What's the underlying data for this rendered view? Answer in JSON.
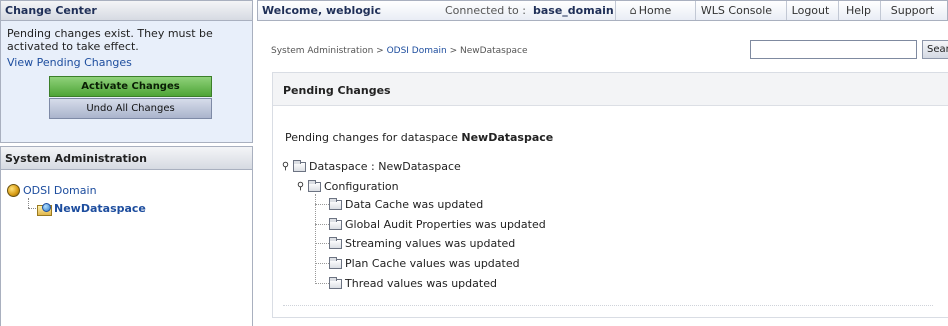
{
  "change_center": {
    "title": "Change Center",
    "message": "Pending changes exist. They must be activated to take effect.",
    "view_link": "View Pending Changes",
    "activate_label": "Activate Changes",
    "undo_label": "Undo All Changes",
    "activate_color": "#4ea537"
  },
  "system_admin": {
    "title": "System Administration",
    "tree": {
      "root_label": "ODSI Domain",
      "root_icon": "globe-icon",
      "child_label": "NewDataspace",
      "child_icon": "dataspace-icon"
    }
  },
  "header": {
    "welcome": "Welcome, weblogic",
    "connected_label": "Connected to :",
    "domain": "base_domain",
    "nav": {
      "home": "Home",
      "console": "WLS Console",
      "logout": "Logout",
      "help": "Help",
      "support": "Support"
    }
  },
  "breadcrumb": {
    "part1": "System Administration >",
    "part2": "ODSI Domain",
    "part3": "> NewDataspace"
  },
  "search": {
    "value": "",
    "button": "Search"
  },
  "main": {
    "title": "Pending Changes",
    "pending_prefix": "Pending changes for dataspace",
    "dataspace_name": "NewDataspace",
    "tree": {
      "root": "Dataspace : NewDataspace",
      "configuration": "Configuration",
      "items": [
        "Data Cache was updated",
        "Global Audit Properties was updated",
        "Streaming values was updated",
        "Plan Cache values was updated",
        "Thread values was updated"
      ]
    }
  },
  "colors": {
    "link": "#1d4d9e",
    "header_text": "#1f2f57"
  }
}
